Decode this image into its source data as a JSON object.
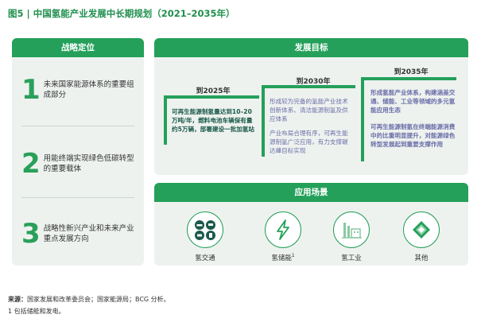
{
  "figure_title": "图5 | 中国氢能产业发展中长期规划（2021–2035年）",
  "strategic_positioning": {
    "header": "战略定位",
    "items": [
      {
        "num": "1",
        "text": "未来国家能源体系的重要组成部分"
      },
      {
        "num": "2",
        "text": "用能终端实现绿色低碳转型的重要载体"
      },
      {
        "num": "3",
        "text": "战略性新兴产业和未来产业重点发展方向"
      }
    ]
  },
  "development_goals": {
    "header": "发展目标",
    "goals": [
      {
        "year": "到2025年",
        "text": "可再生能源制氢量达到10–20万吨/年，燃料电池车辆保有量约5万辆，部署建设一批加氢站",
        "text2": ""
      },
      {
        "year": "到2030年",
        "text": "形成较为完备的氢能产业技术创新体系、清洁能源制氢及供应体系",
        "text2": "产业布局合理有序，可再生能源制氢广泛应用，有力支撑碳达峰目标实现"
      },
      {
        "year": "到2035年",
        "text": "形成氢能产业体系，构建涵盖交通、储能、工业等领域的多元氢能应用生态",
        "text2": "可再生能源制氢在终端能源消费中的比重明显提升，对能源绿色转型发展起到重要支撑作用"
      }
    ]
  },
  "application_scenarios": {
    "header": "应用场景",
    "items": [
      {
        "label": "氢交通",
        "icon": "transport-icon"
      },
      {
        "label": "氢储能",
        "sup": "1",
        "icon": "lightning-icon"
      },
      {
        "label": "氢工业",
        "icon": "factory-icon"
      },
      {
        "label": "其他",
        "icon": "diamond-icon"
      }
    ]
  },
  "source": {
    "label": "来源：",
    "text": "国家发展和改革委员会；国家能源局；BCG 分析。"
  },
  "footnote": "1 包括储能和发电。",
  "colors": {
    "accent_green": "#24a05a",
    "number_green": "#2aa05a",
    "panel_bg": "#eef2ef",
    "dark_teal": "#1a5a4a",
    "lavender": "#6b6fa8"
  }
}
